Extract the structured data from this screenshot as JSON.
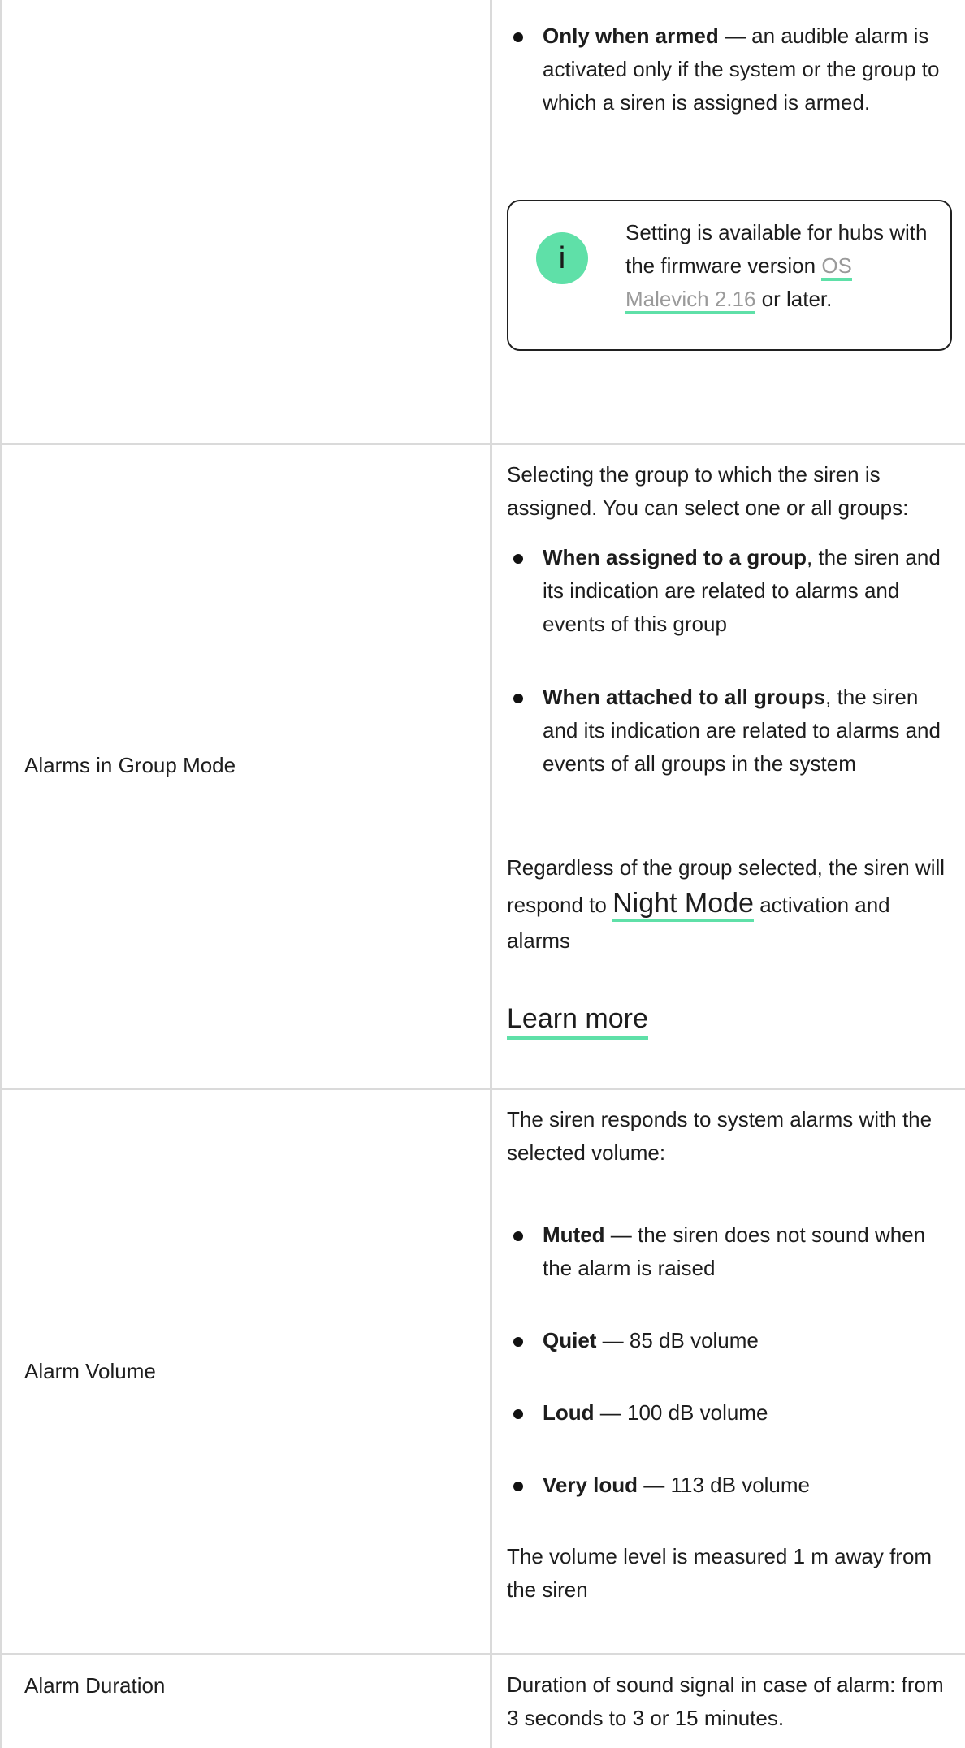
{
  "row1": {
    "armed_bold": "Only when armed",
    "armed_text": " — an audible alarm is activated only if the system or the group to which a siren is assigned is armed.",
    "notice_icon": "info-icon",
    "notice_text_before": "Setting is available for hubs with the firmware version ",
    "notice_link": "OS Malevich 2.16",
    "notice_text_after": " or later."
  },
  "row2": {
    "label": "Alarms in Group Mode",
    "intro": "Selecting the group to which the siren is assigned. You can select one or all groups:",
    "items": [
      {
        "bold": "When assigned to a group",
        "text": ", the siren and its indication are related to alarms and events of this group"
      },
      {
        "bold": "When attached to all groups",
        "text": ", the siren and its indication are related to alarms and events of all groups in the system"
      }
    ],
    "regardless_before": "Regardless of the group selected, the siren will respond to ",
    "night_mode_link": "Night Mode",
    "regardless_after": " activation and alarms",
    "learn_more": "Learn more"
  },
  "row3": {
    "label": "Alarm Volume",
    "intro": "The siren responds to system alarms with the selected volume:",
    "items": [
      {
        "bold": "Muted",
        "text": " — the siren does not sound when the alarm is raised"
      },
      {
        "bold": "Quiet",
        "text": " — 85 dB volume"
      },
      {
        "bold": "Loud",
        "text": " — 100 dB volume"
      },
      {
        "bold": "Very loud",
        "text": " — 113 dB volume"
      }
    ],
    "footer": "The volume level is measured 1 m away from the siren"
  },
  "row4": {
    "label": "Alarm Duration",
    "desc": "Duration of sound signal in case of alarm: from 3 seconds to 3 or 15 minutes."
  }
}
